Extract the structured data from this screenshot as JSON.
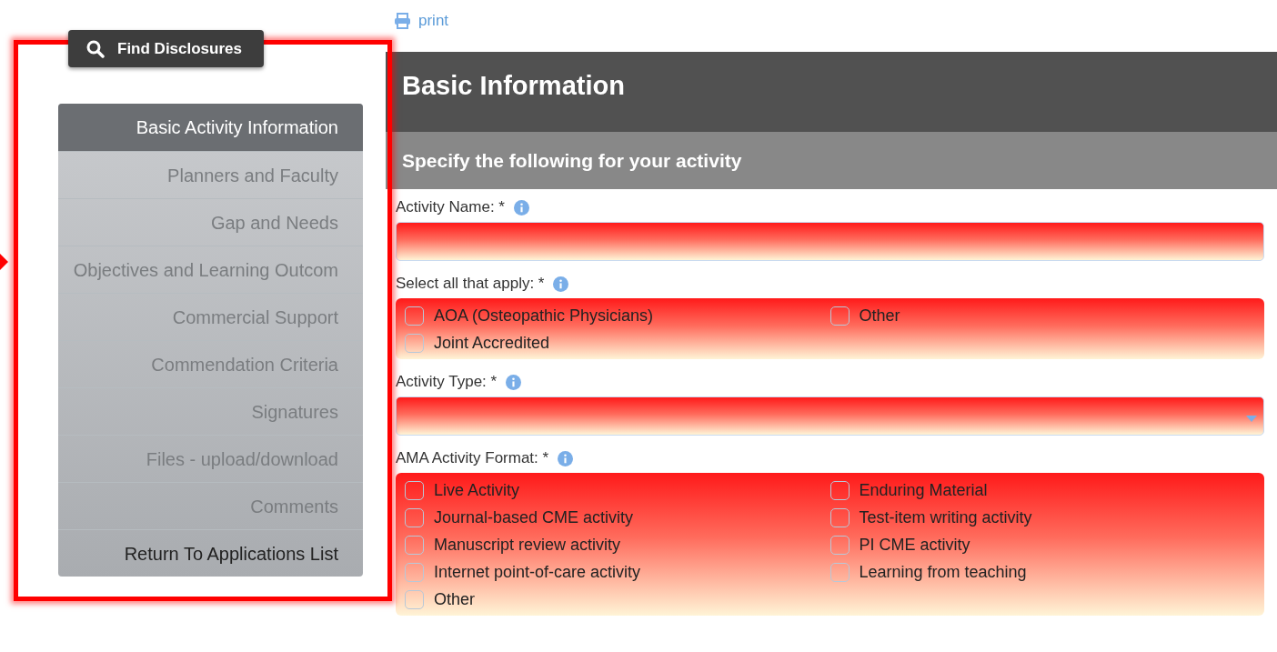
{
  "print_link": "print",
  "find_button": "Find Disclosures",
  "nav": [
    {
      "label": "Basic Activity Information",
      "kind": "section",
      "selected": true
    },
    {
      "label": "Planners and Faculty",
      "kind": "section",
      "selected": false
    },
    {
      "label": "Gap and Needs",
      "kind": "section",
      "selected": false
    },
    {
      "label": "Objectives and Learning Outcom",
      "kind": "section",
      "selected": false
    },
    {
      "label": "Commercial Support",
      "kind": "section",
      "selected": false
    },
    {
      "label": "Commendation Criteria",
      "kind": "section",
      "selected": false
    },
    {
      "label": "Signatures",
      "kind": "section",
      "selected": false
    },
    {
      "label": "Files - upload/download",
      "kind": "section",
      "selected": false
    },
    {
      "label": "Comments",
      "kind": "section",
      "selected": false
    },
    {
      "label": "Return To Applications List",
      "kind": "link",
      "selected": false
    }
  ],
  "title": "Basic Information",
  "subtitle": "Specify the following for your activity",
  "fields": [
    {
      "kind": "text",
      "label": "Activity Name: *"
    },
    {
      "kind": "checkboxes",
      "label": "Select all that apply: *",
      "options": [
        {
          "label": "AOA (Osteopathic Physicians)",
          "checked": false
        },
        {
          "label": "Other",
          "checked": false
        },
        {
          "label": "Joint Accredited",
          "checked": false
        }
      ]
    },
    {
      "kind": "select",
      "label": "Activity Type: *"
    },
    {
      "kind": "checkboxes",
      "label": "AMA Activity Format: *",
      "options": [
        {
          "label": "Live Activity",
          "checked": false
        },
        {
          "label": "Enduring Material",
          "checked": false
        },
        {
          "label": "Journal-based CME activity",
          "checked": false
        },
        {
          "label": "Test-item writing activity",
          "checked": false
        },
        {
          "label": "Manuscript review activity",
          "checked": false
        },
        {
          "label": "PI CME activity",
          "checked": false
        },
        {
          "label": "Internet point-of-care activity",
          "checked": false
        },
        {
          "label": "Learning from teaching",
          "checked": false
        },
        {
          "label": "Other",
          "checked": false
        }
      ]
    }
  ]
}
